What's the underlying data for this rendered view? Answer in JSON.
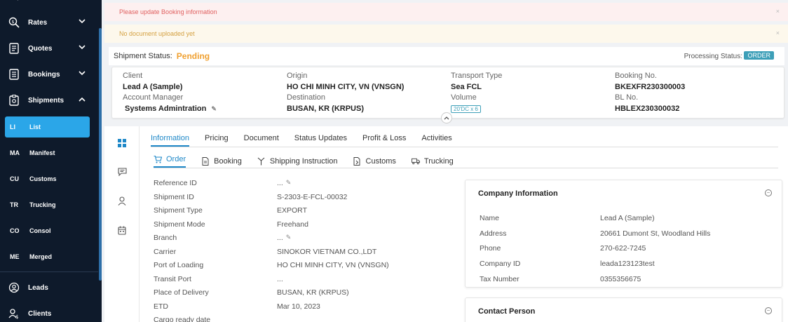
{
  "sidebar": {
    "items": [
      {
        "label": "Rates",
        "icon": "rates-search-icon"
      },
      {
        "label": "Quotes",
        "icon": "quotes-document-icon"
      },
      {
        "label": "Bookings",
        "icon": "bookings-document-icon"
      },
      {
        "label": "Shipments",
        "icon": "shipments-clipboard-icon"
      }
    ],
    "sub_items": [
      {
        "abbr": "LI",
        "label": "List",
        "active": true
      },
      {
        "abbr": "MA",
        "label": "Manifest"
      },
      {
        "abbr": "CU",
        "label": "Customs"
      },
      {
        "abbr": "TR",
        "label": "Trucking"
      },
      {
        "abbr": "CO",
        "label": "Consol"
      },
      {
        "abbr": "ME",
        "label": "Merged"
      }
    ],
    "bottom_items": [
      {
        "label": "Leads",
        "icon": "leads-icon"
      },
      {
        "label": "Clients",
        "icon": "clients-icon"
      }
    ]
  },
  "alerts": {
    "error": "Please update Booking information",
    "warning": "No document uploaded yet",
    "close": "×"
  },
  "status": {
    "shipment_label": "Shipment Status:",
    "shipment_value": "Pending",
    "processing_label": "Processing Status:",
    "processing_value": "ORDER"
  },
  "summary": {
    "client_label": "Client",
    "client_value": "Lead A (Sample)",
    "account_manager_label": "Account Manager",
    "account_manager_value": "Systems Admintration",
    "origin_label": "Origin",
    "origin_value": "HO CHI MINH CITY, VN (VNSGN)",
    "destination_label": "Destination",
    "destination_value": "BUSAN, KR (KRPUS)",
    "transport_label": "Transport Type",
    "transport_value": "Sea FCL",
    "volume_label": "Volume",
    "volume_value": "20'DC x 6",
    "booking_label": "Booking No.",
    "booking_value": "BKEXFR230300003",
    "bl_label": "BL No.",
    "bl_value": "HBLEX230300032"
  },
  "tabs": [
    "Information",
    "Pricing",
    "Document",
    "Status Updates",
    "Profit & Loss",
    "Activities"
  ],
  "subtabs": [
    {
      "label": "Order",
      "icon": "cart-icon"
    },
    {
      "label": "Booking",
      "icon": "booking-doc-icon"
    },
    {
      "label": "Shipping Instruction",
      "icon": "instruction-icon"
    },
    {
      "label": "Customs",
      "icon": "customs-icon"
    },
    {
      "label": "Trucking",
      "icon": "truck-icon"
    }
  ],
  "fields": [
    {
      "label": "Reference ID",
      "value": "...",
      "editable": true
    },
    {
      "label": "Shipment ID",
      "value": "S-2303-E-FCL-00032"
    },
    {
      "label": "Shipment Type",
      "value": "EXPORT"
    },
    {
      "label": "Shipment Mode",
      "value": "Freehand"
    },
    {
      "label": "Branch",
      "value": "...",
      "editable": true
    },
    {
      "label": "Carrier",
      "value": "SINOKOR VIETNAM CO.,LDT"
    },
    {
      "label": "Port of Loading",
      "value": "HO CHI MINH CITY, VN (VNSGN)"
    },
    {
      "label": "Transit Port",
      "value": "..."
    },
    {
      "label": "Place of Delivery",
      "value": "BUSAN, KR (KRPUS)"
    },
    {
      "label": "ETD",
      "value": "Mar 10, 2023"
    },
    {
      "label": "Cargo ready date",
      "value": ""
    }
  ],
  "company_card": {
    "title": "Company Information",
    "rows": [
      {
        "label": "Name",
        "value": "Lead A (Sample)"
      },
      {
        "label": "Address",
        "value": "20661 Dumont St, Woodland Hills"
      },
      {
        "label": "Phone",
        "value": "270-622-7245"
      },
      {
        "label": "Company ID",
        "value": "leada123123test"
      },
      {
        "label": "Tax Number",
        "value": "0355356675"
      }
    ]
  },
  "contact_card": {
    "title": "Contact Person"
  },
  "colors": {
    "sidebar_bg": "#0e1a2b",
    "active_item": "#2ba6e8",
    "accent": "#1e88c8",
    "pending": "#f0a030",
    "order_badge": "#3d9fb8"
  }
}
